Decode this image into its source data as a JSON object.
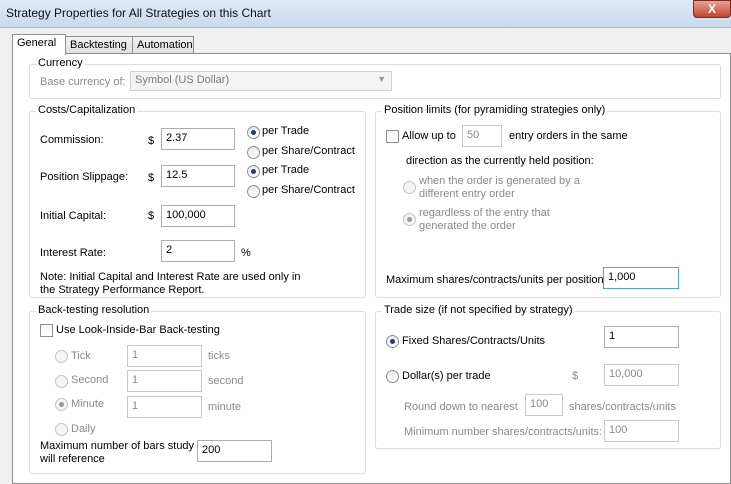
{
  "window": {
    "title": "Strategy Properties for All Strategies on this Chart",
    "close_label": "X"
  },
  "tabs": [
    {
      "label": "General"
    },
    {
      "label": "Backtesting"
    },
    {
      "label": "Automation"
    }
  ],
  "currency": {
    "group_label": "Currency",
    "base_label": "Base currency of:",
    "base_value": "Symbol (US Dollar)"
  },
  "costs": {
    "group_label": "Costs/Capitalization",
    "commission_label": "Commission:",
    "commission_currency": "$",
    "commission_value": "2.37",
    "commission_per_trade": "per Trade",
    "commission_per_share": "per Share/Contract",
    "slippage_label": "Position Slippage:",
    "slippage_currency": "$",
    "slippage_value": "12.5",
    "slippage_per_trade": "per Trade",
    "slippage_per_share": "per Share/Contract",
    "capital_label": "Initial Capital:",
    "capital_currency": "$",
    "capital_value": "100,000",
    "interest_label": "Interest Rate:",
    "interest_value": "2",
    "interest_unit": "%",
    "note_line1": "Note: Initial Capital and Interest Rate are used only in",
    "note_line2": "the Strategy Performance Report."
  },
  "position_limits": {
    "group_label": "Position limits (for pyramiding strategies only)",
    "allow_label": "Allow up to",
    "allow_value": "50",
    "entry_text": "entry orders in the same",
    "direction_text": "direction as the currently held position:",
    "option1_line1": "when the order is generated by a",
    "option1_line2": "different entry order",
    "option2_line1": "regardless of the entry that",
    "option2_line2": "generated the order",
    "max_label": "Maximum shares/contracts/units per position",
    "max_value": "1,000"
  },
  "backtesting": {
    "group_label": "Back-testing resolution",
    "lib_label": "Use Look-Inside-Bar Back-testing",
    "tick_label": "Tick",
    "tick_value": "1",
    "tick_unit": "ticks",
    "second_label": "Second",
    "second_value": "1",
    "second_unit": "second",
    "minute_label": "Minute",
    "minute_value": "1",
    "minute_unit": "minute",
    "daily_label": "Daily",
    "maxbars_line1": "Maximum number of bars study",
    "maxbars_line2": "will reference",
    "maxbars_value": "200"
  },
  "trade_size": {
    "group_label": "Trade size (if not specified by strategy)",
    "fixed_label": "Fixed Shares/Contracts/Units",
    "fixed_value": "1",
    "dollar_label": "Dollar(s) per trade",
    "dollar_currency": "$",
    "dollar_value": "10,000",
    "round_label": "Round down to nearest",
    "round_value": "100",
    "round_unit": "shares/contracts/units",
    "min_label": "Minimum number shares/contracts/units:",
    "min_value": "100"
  }
}
